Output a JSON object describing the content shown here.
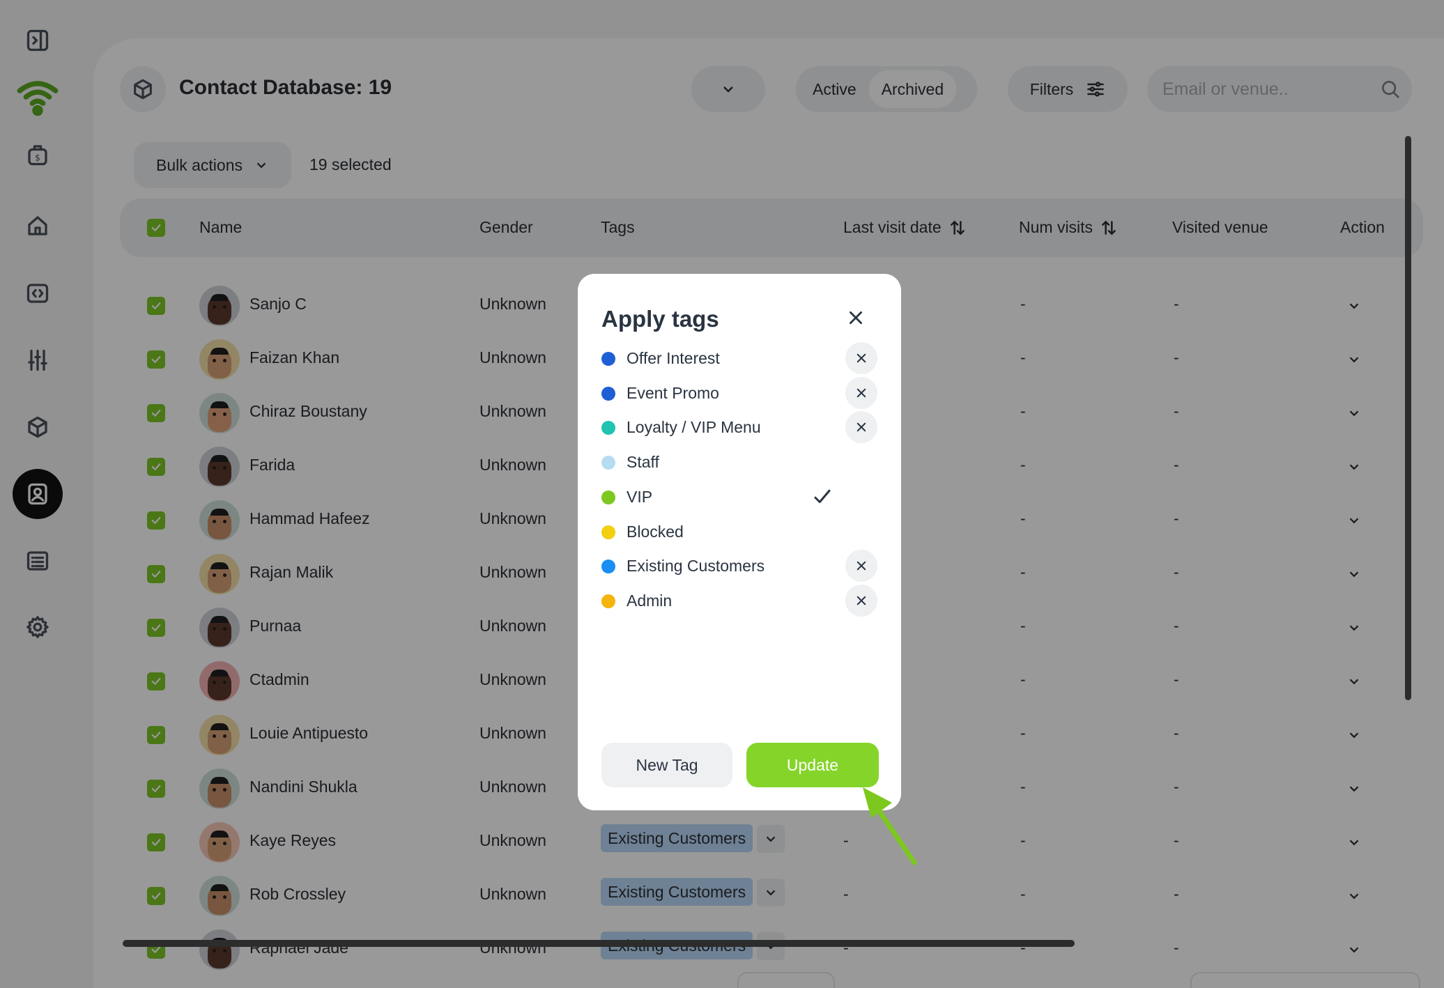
{
  "sidebar": {
    "items": [
      {
        "name": "collapse",
        "icon": "sidebar-collapse-icon"
      },
      {
        "name": "wifi",
        "icon": "wifi-logo-icon",
        "color": "#5aa820"
      },
      {
        "name": "payments",
        "icon": "money-bag-icon"
      },
      {
        "name": "home",
        "icon": "home-icon"
      },
      {
        "name": "code",
        "icon": "code-icon"
      },
      {
        "name": "adjust",
        "icon": "sliders-icon"
      },
      {
        "name": "products",
        "icon": "cube-icon"
      },
      {
        "name": "contacts",
        "icon": "contacts-icon",
        "active": true
      },
      {
        "name": "reports",
        "icon": "list-icon"
      },
      {
        "name": "settings",
        "icon": "gear-icon"
      }
    ]
  },
  "header": {
    "title": "Contact Database: 19",
    "status_tabs": [
      "Active",
      "Archived"
    ],
    "selected_status": "Archived",
    "filters_label": "Filters",
    "search_placeholder": "Email or venue.."
  },
  "toolbar": {
    "bulk_actions_label": "Bulk actions",
    "selected_count": "19 selected"
  },
  "table": {
    "columns": [
      "Name",
      "Gender",
      "Tags",
      "Last visit date",
      "Num visits",
      "Visited venue",
      "Action"
    ],
    "rows": [
      {
        "name": "Sanjo C",
        "gender": "Unknown",
        "tag": "",
        "last_visit": "",
        "num_visits": "-",
        "venue": "-",
        "avatar": "#cfd3d8",
        "skin": "#5b3a2c"
      },
      {
        "name": "Faizan Khan",
        "gender": "Unknown",
        "tag": "",
        "last_visit": "",
        "num_visits": "-",
        "venue": "-",
        "avatar": "#f4dfa8",
        "skin": "#d6a077"
      },
      {
        "name": "Chiraz Boustany",
        "gender": "Unknown",
        "tag": "",
        "last_visit": "",
        "num_visits": "-",
        "venue": "-",
        "avatar": "#cfe1da",
        "skin": "#e2a07a"
      },
      {
        "name": "Farida",
        "gender": "Unknown",
        "tag": "",
        "last_visit": "",
        "num_visits": "-",
        "venue": "-",
        "avatar": "#cfd3d8",
        "skin": "#5b3a2c"
      },
      {
        "name": "Hammad Hafeez",
        "gender": "Unknown",
        "tag": "",
        "last_visit": "",
        "num_visits": "-",
        "venue": "-",
        "avatar": "#cfe1da",
        "skin": "#c88f6a"
      },
      {
        "name": "Rajan Malik",
        "gender": "Unknown",
        "tag": "",
        "last_visit": "",
        "num_visits": "-",
        "venue": "-",
        "avatar": "#f4dfa8",
        "skin": "#d6a077"
      },
      {
        "name": "Purnaa",
        "gender": "Unknown",
        "tag": "",
        "last_visit": "",
        "num_visits": "-",
        "venue": "-",
        "avatar": "#cfd3d8",
        "skin": "#5b3a2c"
      },
      {
        "name": "Ctadmin",
        "gender": "Unknown",
        "tag": "",
        "last_visit": "",
        "num_visits": "-",
        "venue": "-",
        "avatar": "#f2b3b3",
        "skin": "#5b3a2c"
      },
      {
        "name": "Louie Antipuesto",
        "gender": "Unknown",
        "tag": "",
        "last_visit": "",
        "num_visits": "-",
        "venue": "-",
        "avatar": "#f4dfa8",
        "skin": "#d6a077"
      },
      {
        "name": "Nandini Shukla",
        "gender": "Unknown",
        "tag": "",
        "last_visit": "",
        "num_visits": "-",
        "venue": "-",
        "avatar": "#cfe1da",
        "skin": "#c88f6a"
      },
      {
        "name": "Kaye Reyes",
        "gender": "Unknown",
        "tag": "Existing Customers",
        "last_visit": "-",
        "num_visits": "-",
        "venue": "-",
        "avatar": "#f7c9b8",
        "skin": "#d6a077"
      },
      {
        "name": "Rob Crossley",
        "gender": "Unknown",
        "tag": "Existing Customers",
        "last_visit": "-",
        "num_visits": "-",
        "venue": "-",
        "avatar": "#cfe1da",
        "skin": "#c88f6a"
      },
      {
        "name": "Raphael Jade",
        "gender": "Unknown",
        "tag": "Existing Customers",
        "last_visit": "-",
        "num_visits": "-",
        "venue": "-",
        "avatar": "#cfd3d8",
        "skin": "#5b3a2c"
      }
    ]
  },
  "modal": {
    "title": "Apply tags",
    "tags": [
      {
        "label": "Offer Interest",
        "color": "#1f5fd6",
        "state": "remove"
      },
      {
        "label": "Event Promo",
        "color": "#1f5fd6",
        "state": "remove"
      },
      {
        "label": "Loyalty / VIP Menu",
        "color": "#22c3b0",
        "state": "remove"
      },
      {
        "label": "Staff",
        "color": "#b6dcf2",
        "state": "none"
      },
      {
        "label": "VIP",
        "color": "#7cc81f",
        "state": "checked"
      },
      {
        "label": "Blocked",
        "color": "#f2cf0f",
        "state": "none"
      },
      {
        "label": "Existing Customers",
        "color": "#1a8ef2",
        "state": "remove"
      },
      {
        "label": "Admin",
        "color": "#f4b40e",
        "state": "remove"
      }
    ],
    "new_tag_label": "New Tag",
    "update_label": "Update"
  },
  "colors": {
    "accent": "#85d42a",
    "annotation_arrow": "#7cc81f"
  }
}
